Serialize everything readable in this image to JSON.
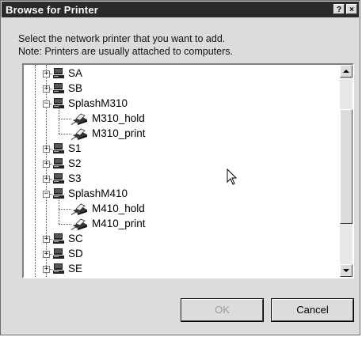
{
  "dialog": {
    "title": "Browse for Printer",
    "help_glyph": "?",
    "close_glyph": "×",
    "instruction_line1": "Select the network printer that you want to add.",
    "instruction_line2": "Note: Printers are usually attached to computers.",
    "ok_label": "OK",
    "cancel_label": "Cancel"
  },
  "tree": {
    "items": [
      {
        "label": "SA",
        "type": "computer",
        "expanded": false
      },
      {
        "label": "SB",
        "type": "computer",
        "expanded": false
      },
      {
        "label": "SplashM310",
        "type": "computer",
        "expanded": true
      },
      {
        "label": "M310_hold",
        "type": "printer"
      },
      {
        "label": "M310_print",
        "type": "printer"
      },
      {
        "label": "S1",
        "type": "computer",
        "expanded": false
      },
      {
        "label": "S2",
        "type": "computer",
        "expanded": false
      },
      {
        "label": "S3",
        "type": "computer",
        "expanded": false
      },
      {
        "label": "SplashM410",
        "type": "computer",
        "expanded": true
      },
      {
        "label": "M410_hold",
        "type": "printer"
      },
      {
        "label": "M410_print",
        "type": "printer"
      },
      {
        "label": "SC",
        "type": "computer",
        "expanded": false
      },
      {
        "label": "SD",
        "type": "computer",
        "expanded": false
      },
      {
        "label": "SE",
        "type": "computer",
        "expanded": false
      }
    ],
    "collapsed_glyph": "+",
    "expanded_glyph": "−"
  },
  "scrollbar": {
    "up_glyph": "▲",
    "down_glyph": "▼"
  }
}
